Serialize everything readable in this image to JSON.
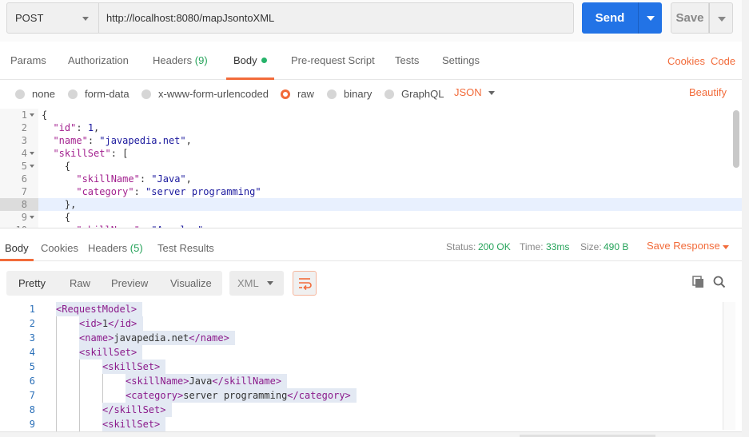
{
  "request": {
    "method": "POST",
    "url": "http://localhost:8080/mapJsontoXML",
    "send_label": "Send",
    "save_label": "Save"
  },
  "request_tabs": {
    "params": "Params",
    "authorization": "Authorization",
    "headers": "Headers",
    "headers_count": "(9)",
    "body": "Body",
    "pre_request": "Pre-request Script",
    "tests": "Tests",
    "settings": "Settings",
    "cookies": "Cookies",
    "code": "Code"
  },
  "body_types": {
    "none": "none",
    "form_data": "form-data",
    "urlencoded": "x-www-form-urlencoded",
    "raw": "raw",
    "binary": "binary",
    "graphql": "GraphQL",
    "format": "JSON",
    "beautify": "Beautify",
    "selected": "raw"
  },
  "request_body": {
    "lines": [
      {
        "n": "1",
        "fold": true,
        "text": "{"
      },
      {
        "n": "2",
        "fold": false,
        "text": "  \"id\": 1,"
      },
      {
        "n": "3",
        "fold": false,
        "text": "  \"name\": \"javapedia.net\","
      },
      {
        "n": "4",
        "fold": true,
        "text": "  \"skillSet\": ["
      },
      {
        "n": "5",
        "fold": true,
        "text": "    {"
      },
      {
        "n": "6",
        "fold": false,
        "text": "      \"skillName\": \"Java\","
      },
      {
        "n": "7",
        "fold": false,
        "text": "      \"category\": \"server programming\""
      },
      {
        "n": "8",
        "fold": false,
        "text": "    },"
      },
      {
        "n": "9",
        "fold": true,
        "text": "    {"
      },
      {
        "n": "10",
        "fold": false,
        "text": "      \"skillName\": \"Angular\","
      }
    ]
  },
  "response_tabs": {
    "body": "Body",
    "cookies": "Cookies",
    "headers": "Headers",
    "headers_count": "(5)",
    "test_results": "Test Results"
  },
  "response_status": {
    "status_label": "Status:",
    "status": "200 OK",
    "time_label": "Time:",
    "time": "33ms",
    "size_label": "Size:",
    "size": "490 B",
    "save_response": "Save Response"
  },
  "response_view": {
    "pretty": "Pretty",
    "raw": "Raw",
    "preview": "Preview",
    "visualize": "Visualize",
    "format": "XML"
  },
  "response_body": {
    "lines": [
      {
        "n": "1",
        "indent": 0,
        "open": "<RequestModel>",
        "text": "",
        "close": ""
      },
      {
        "n": "2",
        "indent": 1,
        "open": "<id>",
        "text": "1",
        "close": "</id>"
      },
      {
        "n": "3",
        "indent": 1,
        "open": "<name>",
        "text": "javapedia.net",
        "close": "</name>"
      },
      {
        "n": "4",
        "indent": 1,
        "open": "<skillSet>",
        "text": "",
        "close": ""
      },
      {
        "n": "5",
        "indent": 2,
        "open": "<skillSet>",
        "text": "",
        "close": ""
      },
      {
        "n": "6",
        "indent": 3,
        "open": "<skillName>",
        "text": "Java",
        "close": "</skillName>"
      },
      {
        "n": "7",
        "indent": 3,
        "open": "<category>",
        "text": "server programming",
        "close": "</category>"
      },
      {
        "n": "8",
        "indent": 2,
        "open": "</skillSet>",
        "text": "",
        "close": ""
      },
      {
        "n": "9",
        "indent": 2,
        "open": "<skillSet>",
        "text": "",
        "close": ""
      }
    ]
  },
  "colors": {
    "accent": "#f26b3a",
    "primary": "#2273e6",
    "success": "#26a35a"
  }
}
